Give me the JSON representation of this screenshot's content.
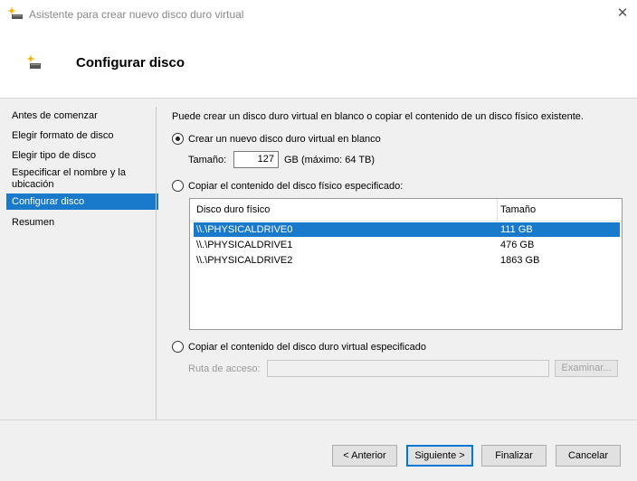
{
  "window": {
    "title": "Asistente para crear nuevo disco duro virtual",
    "close_glyph": "✕"
  },
  "header": {
    "title": "Configurar disco"
  },
  "sidebar": {
    "items": [
      {
        "label": "Antes de comenzar",
        "active": false
      },
      {
        "label": "Elegir formato de disco",
        "active": false
      },
      {
        "label": "Elegir tipo de disco",
        "active": false
      },
      {
        "label": "Especificar el nombre y la ubicación",
        "active": false
      },
      {
        "label": "Configurar disco",
        "active": true
      },
      {
        "label": "Resumen",
        "active": false
      }
    ]
  },
  "main": {
    "intro": "Puede crear un disco duro virtual en blanco o copiar el contenido de un disco físico existente.",
    "option_new": {
      "label": "Crear un nuevo disco duro virtual en blanco",
      "selected": true
    },
    "size": {
      "label": "Tamaño:",
      "value": "127",
      "unit": "GB (máximo: 64 TB)"
    },
    "option_physical": {
      "label": "Copiar el contenido del disco físico especificado:",
      "selected": false
    },
    "table": {
      "columns": [
        "Disco duro físico",
        "Tamaño"
      ],
      "rows": [
        {
          "name": "\\\\.\\PHYSICALDRIVE0",
          "size": "111 GB",
          "selected": true
        },
        {
          "name": "\\\\.\\PHYSICALDRIVE1",
          "size": "476 GB",
          "selected": false
        },
        {
          "name": "\\\\.\\PHYSICALDRIVE2",
          "size": "1863 GB",
          "selected": false
        }
      ]
    },
    "option_virtual": {
      "label": "Copiar el contenido del disco duro virtual especificado",
      "selected": false
    },
    "path": {
      "label": "Ruta de acceso:",
      "value": ""
    },
    "browse_label": "Examinar..."
  },
  "footer": {
    "back": "< Anterior",
    "next": "Siguiente >",
    "finish": "Finalizar",
    "cancel": "Cancelar"
  },
  "icons": {
    "wizard": "disk-sparkle-icon",
    "close": "close-icon"
  },
  "colors": {
    "selection": "#1979ca",
    "default_button_border": "#0078d7"
  }
}
